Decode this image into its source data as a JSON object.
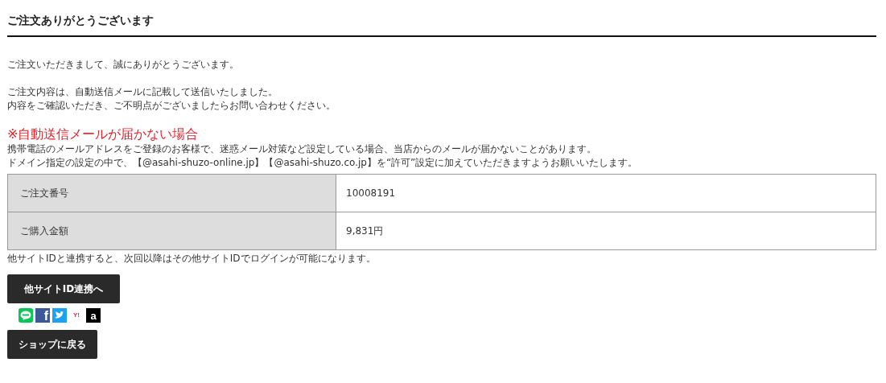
{
  "title": "ご注文ありがとうございます",
  "paragraphs": [
    [
      "ご注文いただきまして、誠にありがとうございます。"
    ],
    [
      "ご注文内容は、自動送信メールに記載して送信いたしました。",
      "内容をご確認いただき、ご不明点がございましたらお問い合わせください。"
    ]
  ],
  "notice": {
    "heading": "※自動送信メールが届かない場合",
    "lines": [
      "携帯電話のメールアドレスをご登録のお客様で、迷惑メール対策など設定している場合、当店からのメールが届かないことがあります。",
      "ドメイン指定の設定の中で、【@asahi-shuzo-online.jp】【@asahi-shuzo.co.jp】を“許可”設定に加えていただきますようお願いいたします。"
    ]
  },
  "table": {
    "rows": [
      {
        "label": "ご注文番号",
        "value": "10008191"
      },
      {
        "label": "ご購入金額",
        "value": "9,831円"
      }
    ]
  },
  "link_note": "他サイトIDと連携すると、次回以降はその他サイトIDでログインが可能になります。",
  "link_button": "他サイトID連携へ",
  "social_logins": [
    {
      "kind": "line"
    },
    {
      "kind": "facebook",
      "glyph": "f"
    },
    {
      "kind": "twitter"
    },
    {
      "kind": "yahoo",
      "glyph": "Y!"
    },
    {
      "kind": "amazon",
      "glyph": "a"
    }
  ],
  "back_button": "ショップに戻る"
}
